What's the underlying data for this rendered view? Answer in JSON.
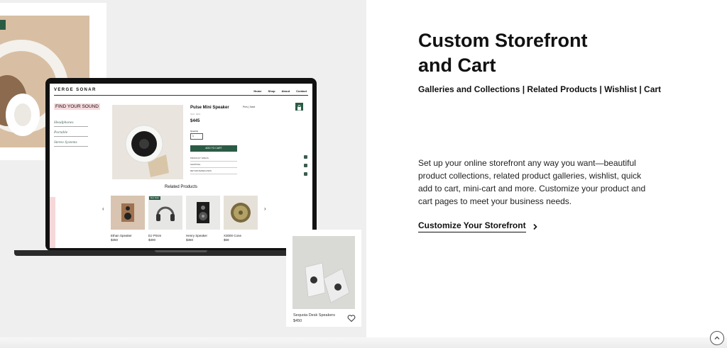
{
  "section": {
    "title_line1": "Custom Storefront",
    "title_line2": "and Cart",
    "subtitle": "Galleries and Collections | Related Products | Wishlist | Cart",
    "description": "Set up your online storefront any way you want—beautiful product collections, related product galleries, wishlist, quick add to cart, mini-cart and more. Customize your product and cart pages to meet your business needs.",
    "cta_label": "Customize Your Storefront"
  },
  "mock_site": {
    "brand": "VERGE SONAR",
    "nav": [
      "Home",
      "Shop",
      "About",
      "Contact"
    ],
    "find_label": "FIND YOUR SOUND",
    "categories": [
      "Headphones",
      "Portable",
      "Stereo Systems"
    ],
    "product": {
      "title": "Pulse Mini Speaker",
      "sku": "SKU: 0001",
      "price": "$445",
      "quantity_label": "Quantity",
      "quantity_value": "1",
      "add_to_cart": "ADD TO CART",
      "prev_next": "Prev  |  Next",
      "info_links": [
        "PRODUCT SPECS",
        "SHIPPING",
        "RETURNS/REFUNDS"
      ]
    },
    "related_title": "Related Products",
    "related": [
      {
        "name": "Ethan Speaker",
        "price": "$350",
        "badge": ""
      },
      {
        "name": "DJ Prism",
        "price": "$300",
        "badge": "Best Seller"
      },
      {
        "name": "Henry Speaker",
        "price": "$350",
        "badge": ""
      },
      {
        "name": "X3000 Cone",
        "price": "$69",
        "badge": ""
      }
    ]
  },
  "wishlist_card": {
    "name": "Sequoia Desk Speakers",
    "price": "$450"
  },
  "colors": {
    "accent_green": "#2c5b45",
    "pink_highlight": "#f7d9dc",
    "stage_background": "#efefef"
  },
  "icons": [
    "bag-icon",
    "instagram-icon",
    "twitter-icon",
    "facebook-icon",
    "heart-icon",
    "chevron-right-icon",
    "arrow-up-icon"
  ]
}
